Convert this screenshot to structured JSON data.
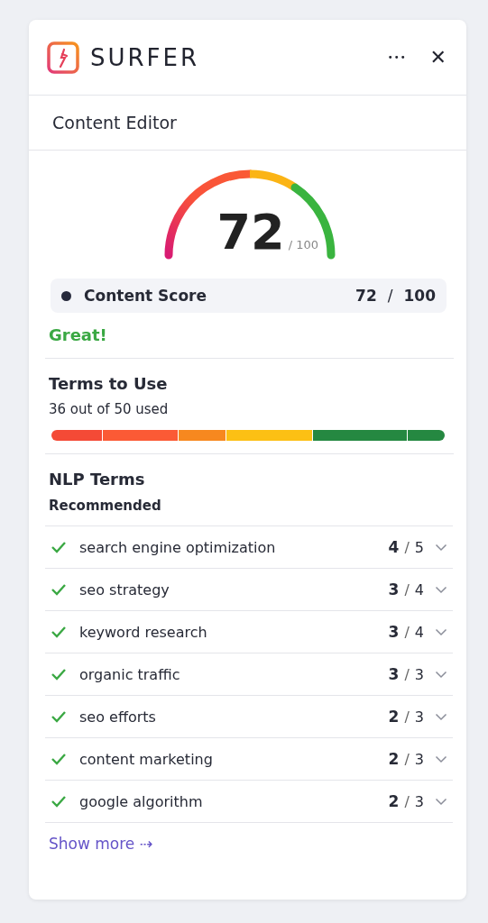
{
  "header": {
    "brand": "SURFER",
    "more": "•••",
    "close": "✕"
  },
  "section_title": "Content Editor",
  "gauge": {
    "score": "72",
    "max": "/ 100"
  },
  "content_score": {
    "label": "Content Score",
    "value": "72",
    "separator": "/",
    "max": "100",
    "rating": "Great!"
  },
  "terms_to_use": {
    "title": "Terms to Use",
    "summary": "36 out of 50 used",
    "segments": [
      {
        "color": "#f44a36"
      },
      {
        "color": "#fb5a35"
      },
      {
        "color": "#f7881f"
      },
      {
        "color": "#fcc014"
      },
      {
        "color": "#258841"
      },
      {
        "color": "#258841"
      }
    ]
  },
  "nlp_terms": {
    "title": "NLP Terms",
    "subtitle": "Recommended",
    "terms": [
      {
        "name": "search engine optimization",
        "used": "4",
        "separator": "/",
        "total": "5",
        "checked": true
      },
      {
        "name": "seo strategy",
        "used": "3",
        "separator": "/",
        "total": "4",
        "checked": true
      },
      {
        "name": "keyword research",
        "used": "3",
        "separator": "/",
        "total": "4",
        "checked": true
      },
      {
        "name": "organic traffic",
        "used": "3",
        "separator": "/",
        "total": "3",
        "checked": true
      },
      {
        "name": "seo efforts",
        "used": "2",
        "separator": "/",
        "total": "3",
        "checked": true
      },
      {
        "name": "content marketing",
        "used": "2",
        "separator": "/",
        "total": "3",
        "checked": true
      },
      {
        "name": "google algorithm",
        "used": "2",
        "separator": "/",
        "total": "3",
        "checked": true
      }
    ],
    "show_more": "Show more ⇢"
  }
}
